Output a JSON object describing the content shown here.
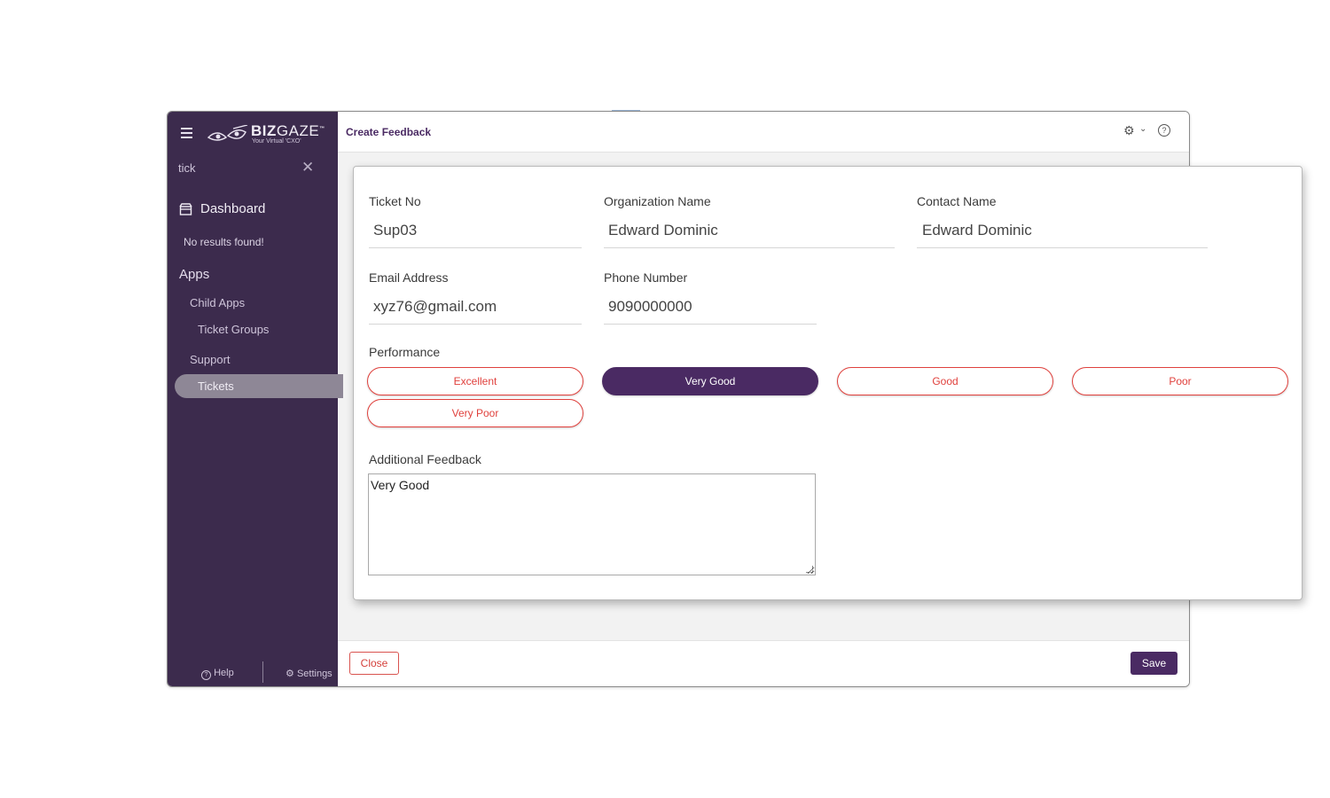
{
  "sidebar": {
    "logo": {
      "brand_bold": "BIZ",
      "brand_light": "GAZE",
      "trademark": "™",
      "tagline": "Your Virtual 'CXO'"
    },
    "search": {
      "value": "tick",
      "clear_icon": "close-icon"
    },
    "dashboard_label": "Dashboard",
    "no_results": "No results found!",
    "apps_title": "Apps",
    "items": [
      {
        "label": "Child Apps"
      },
      {
        "label": "Ticket Groups"
      },
      {
        "label": "Support"
      },
      {
        "label": "Tickets",
        "active": true
      }
    ],
    "footer": {
      "help": "Help",
      "settings": "Settings"
    }
  },
  "header": {
    "title": "Create Feedback",
    "icons": [
      "gear-icon",
      "chevron-down-icon",
      "help-icon"
    ]
  },
  "form": {
    "ticket_no": {
      "label": "Ticket No",
      "value": "Sup03"
    },
    "organization_name": {
      "label": "Organization Name",
      "value": "Edward Dominic"
    },
    "contact_name": {
      "label": "Contact Name",
      "value": "Edward Dominic"
    },
    "email": {
      "label": "Email Address",
      "value": "xyz76@gmail.com"
    },
    "phone": {
      "label": "Phone Number",
      "value": "9090000000"
    },
    "performance": {
      "label": "Performance",
      "options": [
        "Excellent",
        "Very Good",
        "Good",
        "Poor",
        "Very Poor"
      ],
      "selected": "Very Good"
    },
    "additional_feedback": {
      "label": "Additional Feedback",
      "value": "Very Good"
    }
  },
  "footer": {
    "close_label": "Close",
    "save_label": "Save"
  },
  "colors": {
    "sidebar_bg": "#3c2b4d",
    "accent": "#4a2a63",
    "danger": "#e0413d"
  }
}
